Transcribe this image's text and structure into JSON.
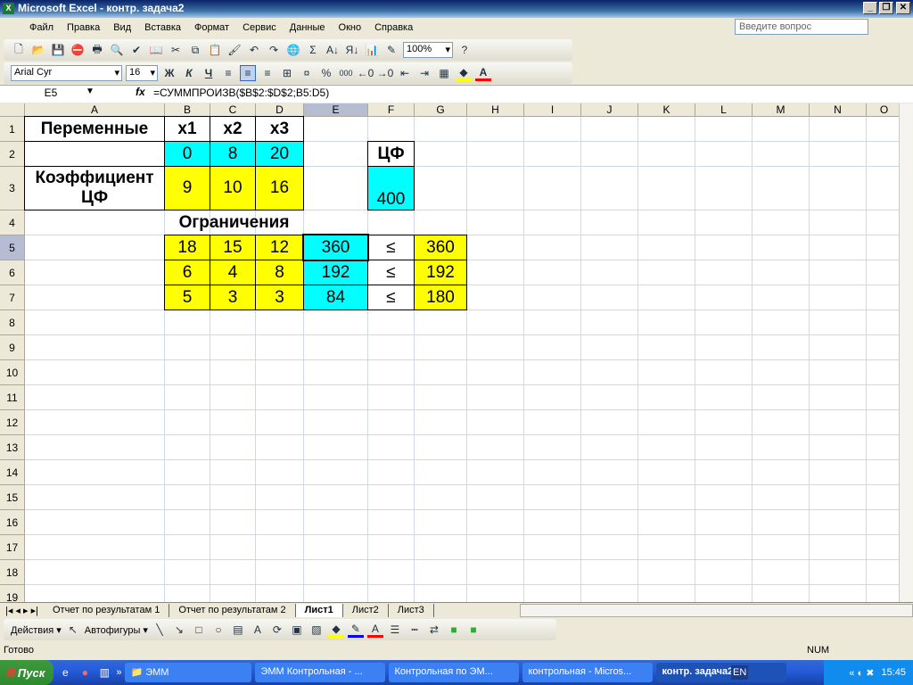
{
  "window": {
    "title": "Microsoft Excel - контр. задача2"
  },
  "menu": [
    "Файл",
    "Правка",
    "Вид",
    "Вставка",
    "Формат",
    "Сервис",
    "Данные",
    "Окно",
    "Справка"
  ],
  "help_placeholder": "Введите вопрос",
  "toolbar": {
    "zoom": "100%",
    "font": "Arial Cyr",
    "size": "16",
    "bold": "Ж",
    "italic": "К",
    "underline": "Ч"
  },
  "formula_bar": {
    "name_box": "E5",
    "fx": "fx",
    "formula": "=СУММПРОИЗВ($B$2:$D$2;B5:D5)"
  },
  "columns": [
    "A",
    "B",
    "C",
    "D",
    "E",
    "F",
    "G",
    "H",
    "I",
    "J",
    "K",
    "L",
    "M",
    "N",
    "O"
  ],
  "rows": [
    "1",
    "2",
    "3",
    "4",
    "5",
    "6",
    "7",
    "8",
    "9",
    "10",
    "11",
    "12",
    "13",
    "14",
    "15",
    "16",
    "17",
    "18",
    "19"
  ],
  "active_cell": "E5",
  "colors": {
    "yellow": "#ffff00",
    "cyan": "#00ffff"
  },
  "cells": [
    {
      "ref": "A1",
      "v": "Переменные",
      "b": 1,
      "box": 1
    },
    {
      "ref": "B1",
      "v": "x1",
      "b": 1,
      "box": 1
    },
    {
      "ref": "C1",
      "v": "x2",
      "b": 1,
      "box": 1
    },
    {
      "ref": "D1",
      "v": "x3",
      "b": 1,
      "box": 1
    },
    {
      "ref": "A2",
      "v": "",
      "box": 1
    },
    {
      "ref": "B2",
      "v": "0",
      "fill": "cyan",
      "box": 1
    },
    {
      "ref": "C2",
      "v": "8",
      "fill": "cyan",
      "box": 1
    },
    {
      "ref": "D2",
      "v": "20",
      "fill": "cyan",
      "box": 1
    },
    {
      "ref": "F2",
      "v": "ЦФ",
      "b": 1,
      "box": 1
    },
    {
      "ref": "A3",
      "v": "Коэффициент ЦФ",
      "b": 1,
      "box": 1
    },
    {
      "ref": "B3",
      "v": "9",
      "fill": "yellow",
      "box": 1
    },
    {
      "ref": "C3",
      "v": "10",
      "fill": "yellow",
      "box": 1
    },
    {
      "ref": "D3",
      "v": "16",
      "fill": "yellow",
      "box": 1
    },
    {
      "ref": "F3",
      "v": "400",
      "fill": "cyan",
      "box": 1,
      "bottom": 1
    },
    {
      "ref": "B4",
      "v": "Ограничения",
      "b": 1,
      "span": 3
    },
    {
      "ref": "B5",
      "v": "18",
      "fill": "yellow",
      "box": 1
    },
    {
      "ref": "C5",
      "v": "15",
      "fill": "yellow",
      "box": 1
    },
    {
      "ref": "D5",
      "v": "12",
      "fill": "yellow",
      "box": 1
    },
    {
      "ref": "E5",
      "v": "360",
      "fill": "cyan",
      "box": 1
    },
    {
      "ref": "F5",
      "v": "≤",
      "box": 1
    },
    {
      "ref": "G5",
      "v": "360",
      "fill": "yellow",
      "box": 1
    },
    {
      "ref": "B6",
      "v": "6",
      "fill": "yellow",
      "box": 1
    },
    {
      "ref": "C6",
      "v": "4",
      "fill": "yellow",
      "box": 1
    },
    {
      "ref": "D6",
      "v": "8",
      "fill": "yellow",
      "box": 1
    },
    {
      "ref": "E6",
      "v": "192",
      "fill": "cyan",
      "box": 1
    },
    {
      "ref": "F6",
      "v": "≤",
      "box": 1
    },
    {
      "ref": "G6",
      "v": "192",
      "fill": "yellow",
      "box": 1
    },
    {
      "ref": "B7",
      "v": "5",
      "fill": "yellow",
      "box": 1
    },
    {
      "ref": "C7",
      "v": "3",
      "fill": "yellow",
      "box": 1
    },
    {
      "ref": "D7",
      "v": "3",
      "fill": "yellow",
      "box": 1
    },
    {
      "ref": "E7",
      "v": "84",
      "fill": "cyan",
      "box": 1
    },
    {
      "ref": "F7",
      "v": "≤",
      "box": 1
    },
    {
      "ref": "G7",
      "v": "180",
      "fill": "yellow",
      "box": 1
    }
  ],
  "sheet_tabs": [
    {
      "label": "Отчет по результатам 1"
    },
    {
      "label": "Отчет по результатам 2"
    },
    {
      "label": "Лист1",
      "active": true
    },
    {
      "label": "Лист2"
    },
    {
      "label": "Лист3"
    }
  ],
  "drawing": {
    "actions": "Действия ▾",
    "autoshapes": "Автофигуры ▾"
  },
  "status": {
    "text": "Готово",
    "num": "NUM"
  },
  "taskbar": {
    "start": "Пуск",
    "folder": "ЭММ",
    "buttons": [
      "ЭММ Контрольная - ...",
      "Контрольная по ЭМ...",
      "контрольная - Micros...",
      "контр. задача2"
    ],
    "lang": "EN",
    "clock": "15:45"
  }
}
